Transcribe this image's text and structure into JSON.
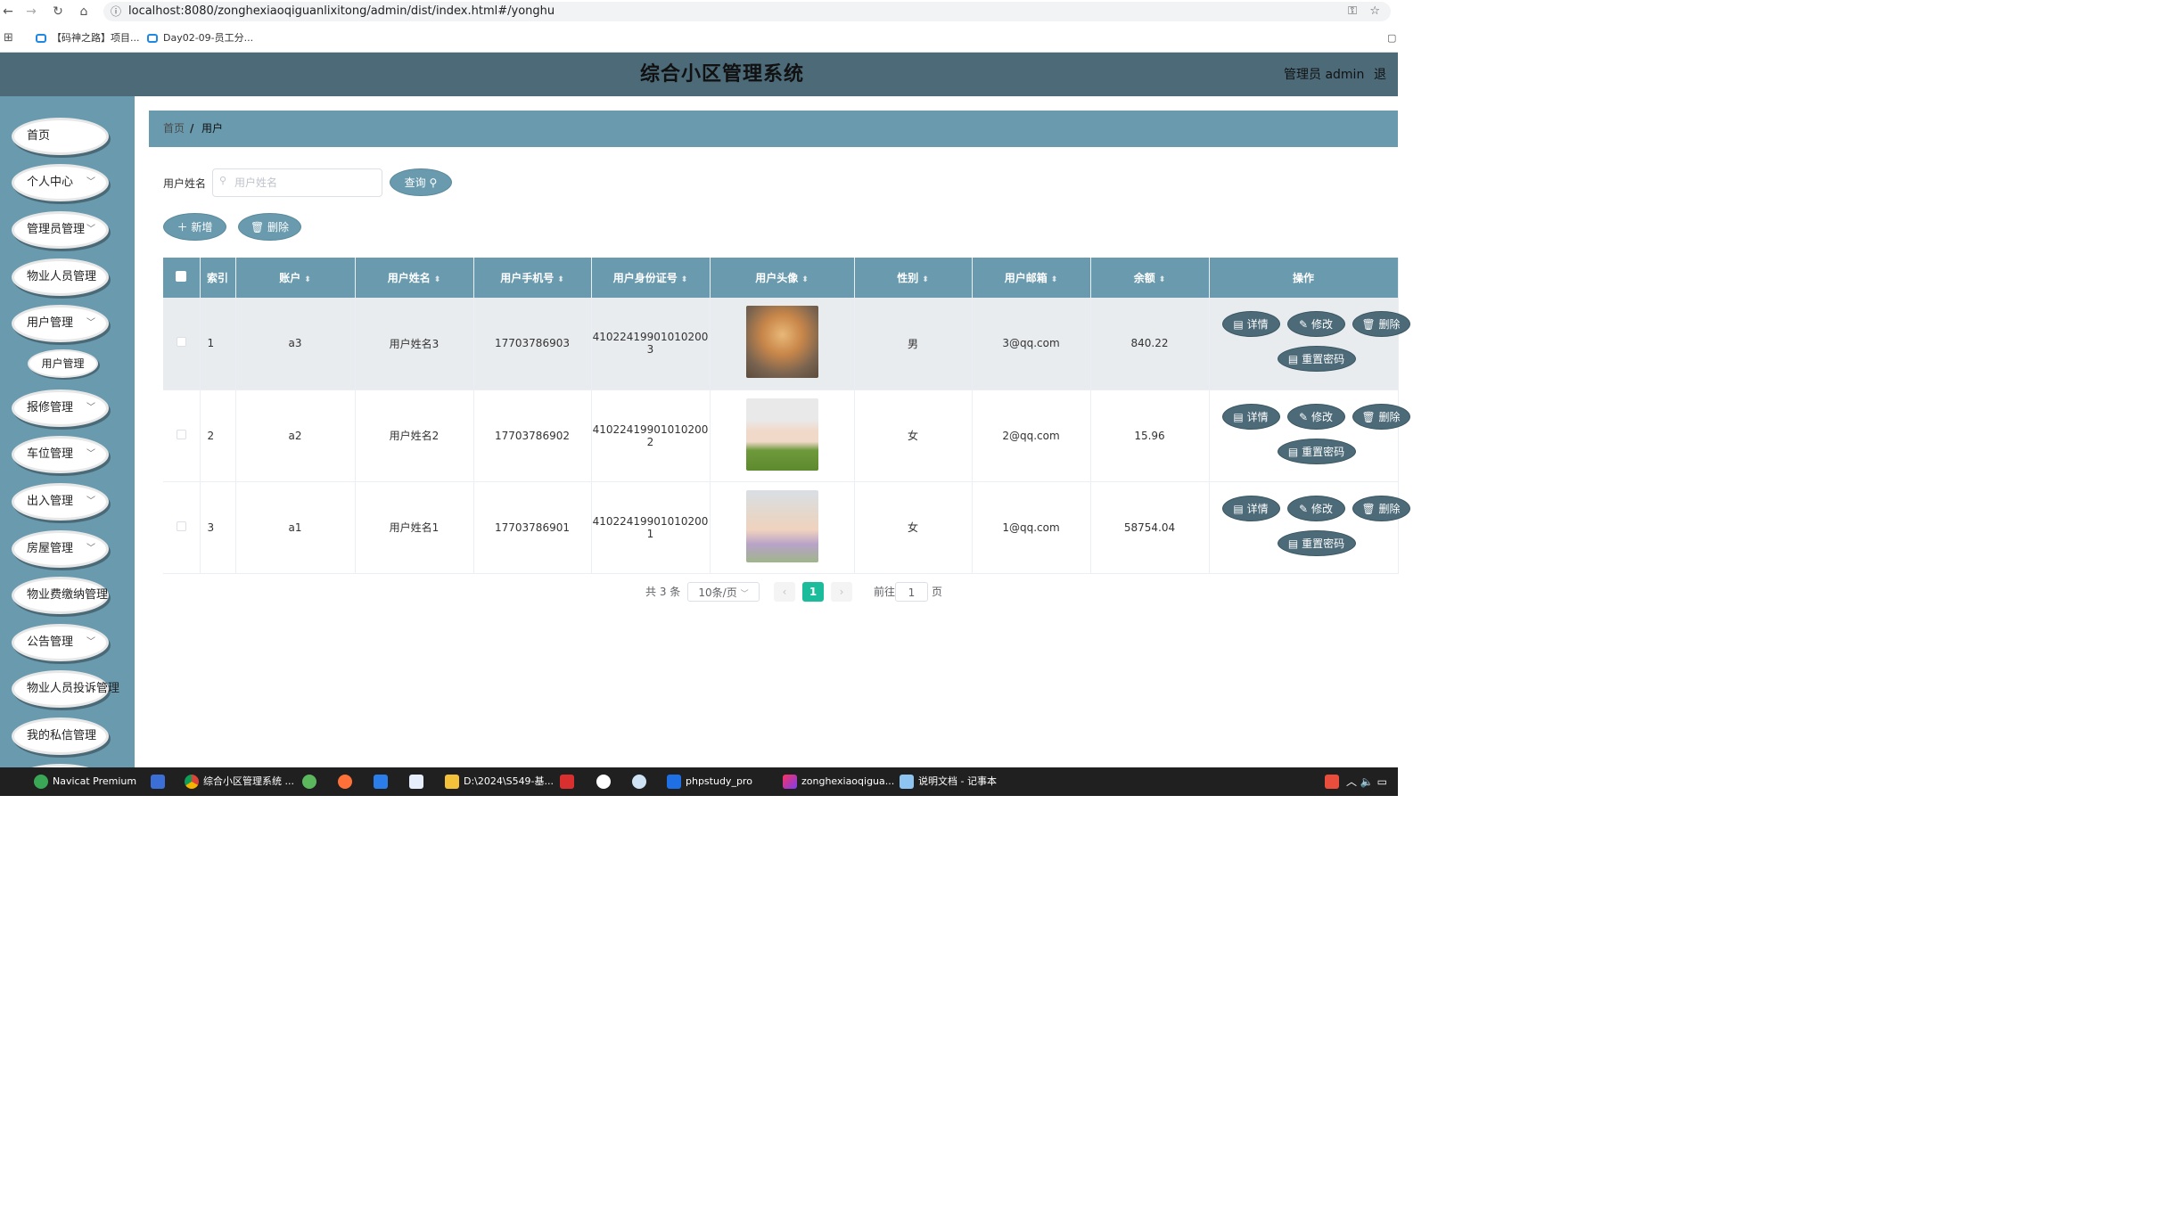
{
  "browser": {
    "url": "localhost:8080/zonghexiaoqiguanlixitong/admin/dist/index.html#/yonghu",
    "bookmarks": [
      "【码神之路】项目...",
      "Day02-09-员工分..."
    ]
  },
  "header": {
    "title": "综合小区管理系统",
    "user": "管理员 admin",
    "logout": "退出"
  },
  "sidebar": {
    "items": [
      "首页",
      "个人中心",
      "管理员管理",
      "物业人员管理",
      "用户管理",
      "报修管理",
      "车位管理",
      "出入管理",
      "房屋管理",
      "物业费缴纳管理",
      "公告管理",
      "物业人员投诉管理",
      "我的私信管理"
    ],
    "submenu": "用户管理"
  },
  "breadcrumb": {
    "home": "首页",
    "sep": "/",
    "current": "用户"
  },
  "search": {
    "label": "用户姓名",
    "placeholder": "用户姓名",
    "button": "查询"
  },
  "toolbar": {
    "add": "新增",
    "delete": "删除"
  },
  "table": {
    "headers": [
      "索引",
      "账户",
      "用户姓名",
      "用户手机号",
      "用户身份证号",
      "用户头像",
      "性别",
      "用户邮箱",
      "余额",
      "操作"
    ],
    "rows": [
      {
        "idx": "1",
        "account": "a3",
        "name": "用户姓名3",
        "phone": "17703786903",
        "id1": "41022419901010200",
        "id2": "3",
        "gender": "男",
        "email": "3@qq.com",
        "balance": "840.22"
      },
      {
        "idx": "2",
        "account": "a2",
        "name": "用户姓名2",
        "phone": "17703786902",
        "id1": "41022419901010200",
        "id2": "2",
        "gender": "女",
        "email": "2@qq.com",
        "balance": "15.96"
      },
      {
        "idx": "3",
        "account": "a1",
        "name": "用户姓名1",
        "phone": "17703786901",
        "id1": "41022419901010200",
        "id2": "1",
        "gender": "女",
        "email": "1@qq.com",
        "balance": "58754.04"
      }
    ],
    "actions": {
      "detail": "详情",
      "edit": "修改",
      "delete": "删除",
      "reset": "重置密码"
    }
  },
  "pagination": {
    "total": "共 3 条",
    "size": "10条/页",
    "page": "1",
    "goto": "前往",
    "goto_value": "1",
    "page_unit": "页"
  },
  "taskbar": [
    "Navicat Premium",
    "综合小区管理系统 ...",
    "D:\\2024\\S549-基...",
    "phpstudy_pro",
    "zonghexiaoqigua...",
    "说明文档 - 记事本"
  ]
}
